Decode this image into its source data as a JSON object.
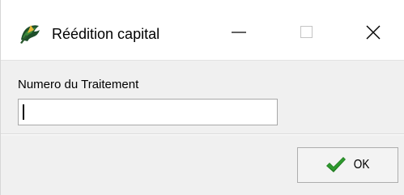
{
  "window": {
    "title": "Réédition capital",
    "icon": "app-logo-icon",
    "controls": {
      "minimize": "minimize-icon",
      "maximize": "maximize-icon",
      "close": "close-icon"
    }
  },
  "form": {
    "field_label": "Numero du Traitement",
    "field_value": "",
    "field_placeholder": ""
  },
  "footer": {
    "ok_label": "OK",
    "ok_icon": "checkmark-icon"
  },
  "colors": {
    "window_background": "#f0f0f0",
    "titlebar_background": "#ffffff",
    "checkmark": "#1f7a1f"
  }
}
